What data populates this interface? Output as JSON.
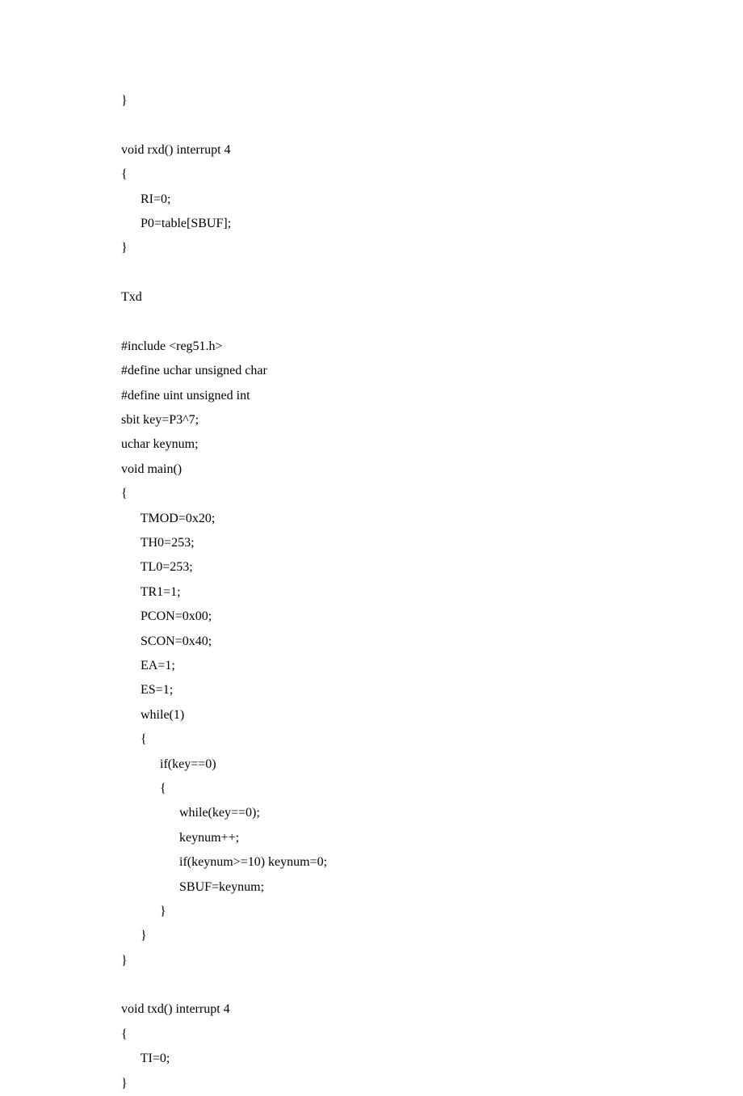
{
  "code": "}\n\nvoid rxd() interrupt 4\n{\n      RI=0;\n      P0=table[SBUF];\n}\n\nTxd\n\n#include <reg51.h>\n#define uchar unsigned char\n#define uint unsigned int\nsbit key=P3^7;\nuchar keynum;\nvoid main()\n{\n      TMOD=0x20;\n      TH0=253;\n      TL0=253;\n      TR1=1;\n      PCON=0x00;\n      SCON=0x40;\n      EA=1;\n      ES=1;\n      while(1)\n      {\n            if(key==0)\n            {\n                  while(key==0);\n                  keynum++;\n                  if(keynum>=10) keynum=0;\n                  SBUF=keynum;\n            }\n      }\n}\n\nvoid txd() interrupt 4\n{\n      TI=0;\n}"
}
